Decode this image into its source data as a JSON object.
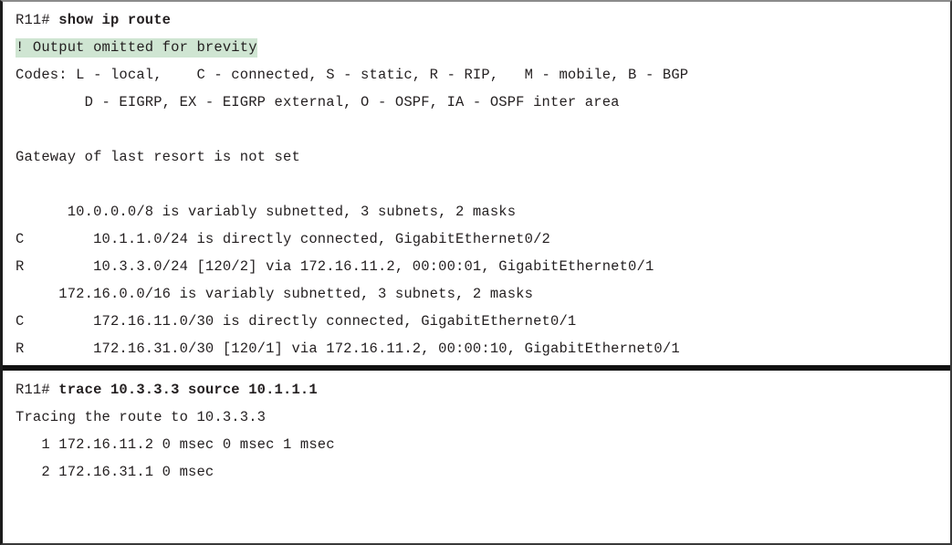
{
  "figure": {
    "accent_highlight_color": "#cfe5d2",
    "text_color": "#231f20",
    "divider_color": "#111111"
  },
  "top_pane": {
    "prompt_line": {
      "prompt": "R11# ",
      "command": "show ip route"
    },
    "omitted_note": "! Output omitted for brevity",
    "codes_line_1": "Codes: L - local,    C - connected, S - static, R - RIP,   M - mobile, B - BGP",
    "codes_line_2": "        D - EIGRP, EX - EIGRP external, O - OSPF, IA - OSPF inter area",
    "gateway_line": "Gateway of last resort is not set",
    "routes": [
      "      10.0.0.0/8 is variably subnetted, 3 subnets, 2 masks",
      "C        10.1.1.0/24 is directly connected, GigabitEthernet0/2",
      "R        10.3.3.0/24 [120/2] via 172.16.11.2, 00:00:01, GigabitEthernet0/1",
      "     172.16.0.0/16 is variably subnetted, 3 subnets, 2 masks",
      "C        172.16.11.0/30 is directly connected, GigabitEthernet0/1",
      "R        172.16.31.0/30 [120/1] via 172.16.11.2, 00:00:10, GigabitEthernet0/1"
    ]
  },
  "bottom_pane": {
    "prompt_line": {
      "prompt": "R11# ",
      "command": "trace 10.3.3.3 source 10.1.1.1"
    },
    "tracing_line": "Tracing the route to 10.3.3.3",
    "hops": [
      "   1 172.16.11.2 0 msec 0 msec 1 msec",
      "   2 172.16.31.1 0 msec"
    ]
  }
}
